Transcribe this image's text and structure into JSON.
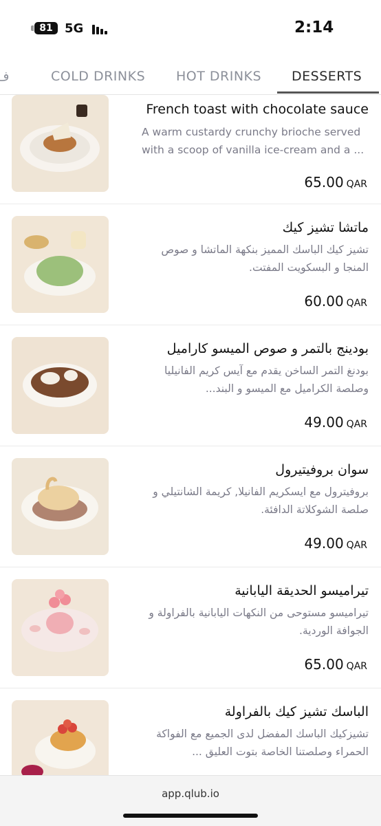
{
  "status": {
    "battery": "81",
    "network": "5G",
    "time": "2:14"
  },
  "tabs": {
    "partial_label": "ف",
    "items": [
      {
        "label": "COLD DRINKS"
      },
      {
        "label": "HOT DRINKS"
      },
      {
        "label": "DESSERTS"
      }
    ]
  },
  "menu": {
    "items": [
      {
        "name": "French toast with chocolate sauce",
        "desc": "A warm custardy crunchy brioche served with a scoop of vanilla ice-cream and a ...",
        "price": "65.00",
        "currency": "QAR"
      },
      {
        "name": "ماتشا تشيز كيك",
        "desc": "تشيز كيك الباسك المميز بنكهة الماتشا و صوص المنجا و البسكويت المفتت.",
        "price": "60.00",
        "currency": "QAR"
      },
      {
        "name": "بودينج بالتمر و صوص الميسو كاراميل",
        "desc": "بودنغ التمر الساخن يقدم مع آيس كريم الفانيليا وصلصة الكراميل مع الميسو و البند...",
        "price": "49.00",
        "currency": "QAR"
      },
      {
        "name": "سوان بروفيتيرول",
        "desc": "بروفيترول مع ايسكريم الفانيلا, كريمة الشانتيلي و صلصة الشوكلاتة الدافئة.",
        "price": "49.00",
        "currency": "QAR"
      },
      {
        "name": "تيراميسو الحديقة اليابانية",
        "desc": "تيراميسو مستوحى من النكهات اليابانية بالفراولة و الجوافة الوردية.",
        "price": "65.00",
        "currency": "QAR"
      },
      {
        "name": "الباسك تشيز كيك بالفراولة",
        "desc": "تشيزكيك الباسك المفضل لدى الجميع مع الفواكة الحمراء وصلصتنا الخاصة بتوت العليق ...",
        "price": "",
        "currency": ""
      }
    ]
  },
  "footer": {
    "url": "app.qlub.io"
  }
}
